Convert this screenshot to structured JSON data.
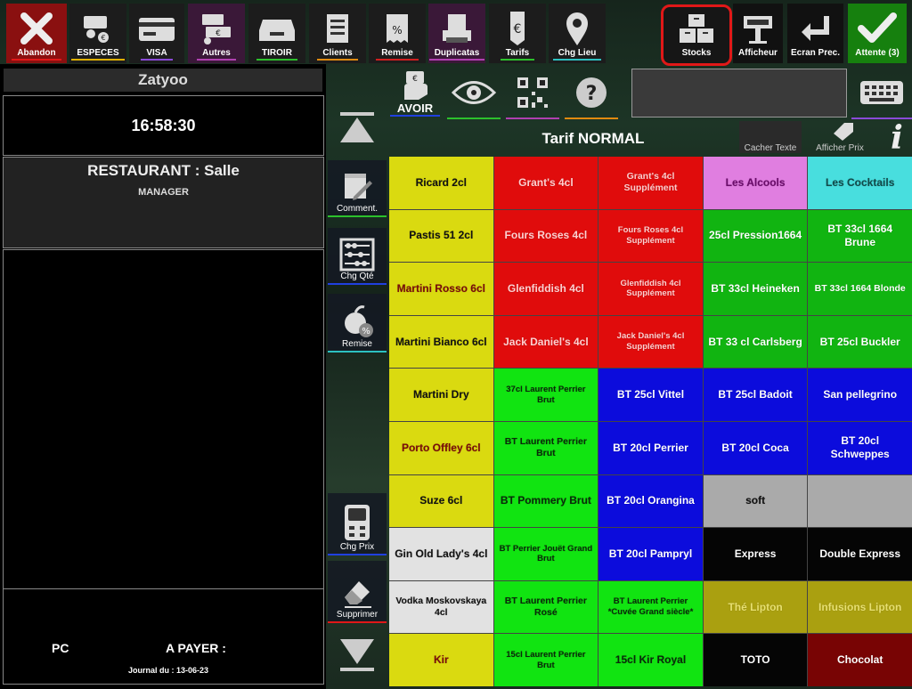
{
  "toolbar": {
    "abandon": "Abandon",
    "especes": "ESPECES",
    "visa": "VISA",
    "autres": "Autres",
    "tiroir": "TIROIR",
    "clients": "Clients",
    "remise": "Remise",
    "duplicatas": "Duplicatas",
    "tarifs": "Tarifs",
    "chg_lieu": "Chg Lieu",
    "stocks": "Stocks",
    "afficheur": "Afficheur",
    "ecran_prec": "Ecran Prec.",
    "attente": "Attente (3)"
  },
  "left": {
    "brand": "Zatyoo",
    "clock": "16:58:30",
    "table": "RESTAURANT : Salle",
    "user": "MANAGER",
    "pc": "PC",
    "a_payer": "A PAYER :",
    "journal": "Journal du : 13-06-23"
  },
  "side": {
    "comment": "Comment.",
    "chg_qte": "Chg Qté",
    "remise": "Remise",
    "chg_prix": "Chg Prix",
    "supprimer": "Supprimer"
  },
  "topicons": {
    "avoir": "AVOIR",
    "tarif": "Tarif NORMAL",
    "cacher_texte": "Cacher Texte",
    "afficher_prix": "Afficher Prix"
  },
  "products": [
    [
      "Ricard 2cl",
      "Grant's 4cl",
      "Grant's 4cl Supplément",
      "Les Alcools",
      "Les Cocktails"
    ],
    [
      "Pastis 51 2cl",
      "Fours Roses 4cl",
      "Fours Roses 4cl Supplément",
      "25cl Pression1664",
      "BT 33cl 1664 Brune"
    ],
    [
      "Martini Rosso 6cl",
      "Glenfiddish 4cl",
      "Glenfiddish 4cl Supplément",
      "BT 33cl Heineken",
      "BT 33cl 1664 Blonde"
    ],
    [
      "Martini Bianco 6cl",
      "Jack Daniel's 4cl",
      "Jack Daniel's 4cl Supplément",
      "BT 33 cl Carlsberg",
      "BT 25cl Buckler"
    ],
    [
      "Martini Dry",
      "37cl Laurent Perrier Brut",
      "BT 25cl Vittel",
      "BT 25cl Badoit",
      "San pellegrino"
    ],
    [
      "Porto Offley 6cl",
      "BT Laurent Perrier Brut",
      "BT 20cl Perrier",
      "BT 20cl Coca",
      "BT 20cl Schweppes"
    ],
    [
      "Suze 6cl",
      "BT Pommery Brut",
      "BT 20cl Orangina",
      "soft",
      ""
    ],
    [
      "Gin Old Lady's 4cl",
      "BT Perrier Jouët Grand Brut",
      "BT 20cl Pampryl",
      "Express",
      "Double Express"
    ],
    [
      "Vodka Moskovskaya 4cl",
      "BT Laurent Perrier Rosé",
      "BT Laurent Perrier *Cuvée Grand siècle*",
      "Thé Lipton",
      "Infusions Lipton"
    ],
    [
      "Kir",
      "15cl Laurent Perrier Brut",
      "15cl Kir Royal",
      "TOTO",
      "Chocolat"
    ]
  ],
  "colors": {
    "yellow": "#dada10",
    "red": "#e00c0c",
    "pink": "#e07ee0",
    "cyan": "#48dede",
    "green": "#11b411",
    "lime": "#11e411",
    "blue": "#0c0cdc",
    "gray": "#aaaaaa",
    "black": "#050505",
    "olive": "#aaa010",
    "maroon": "#780404",
    "white": "#e2e2e2",
    "highlight": "#e01818"
  }
}
